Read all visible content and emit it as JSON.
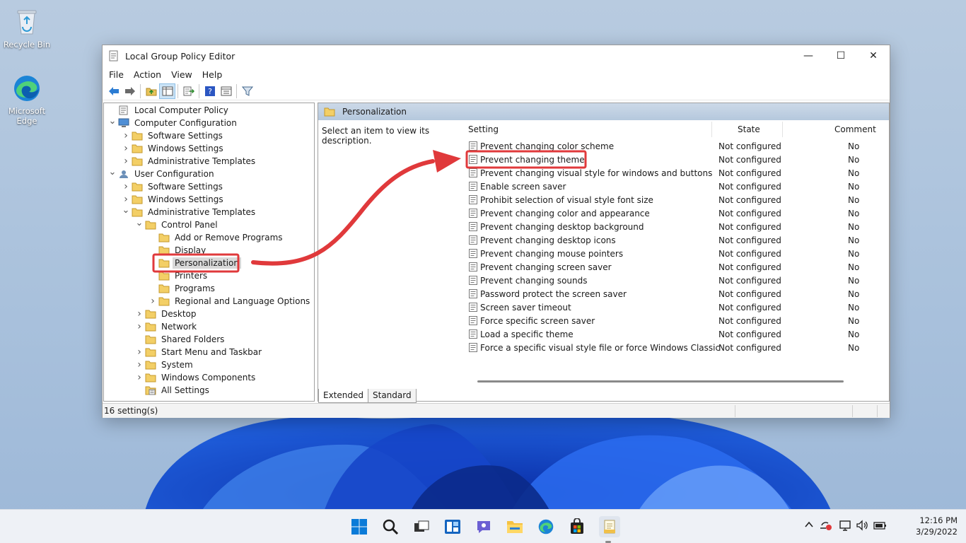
{
  "desktop": {
    "icons": [
      {
        "label": "Recycle Bin",
        "icon": "recycle-bin-icon"
      },
      {
        "label": "Microsoft Edge",
        "icon": "edge-icon"
      }
    ]
  },
  "window": {
    "title": "Local Group Policy Editor",
    "controls": {
      "minimize": "—",
      "maximize": "☐",
      "close": "✕"
    }
  },
  "menu": [
    "File",
    "Action",
    "View",
    "Help"
  ],
  "toolbar": [
    "back-icon",
    "forward-icon",
    "up-folder-icon",
    "show-hide-tree-icon",
    "export-list-icon",
    "help-icon",
    "properties-icon",
    "filter-icon"
  ],
  "tree": [
    {
      "label": "Local Computer Policy",
      "icon": "computer-policy-icon"
    },
    {
      "label": "Computer Configuration",
      "icon": "computer-icon"
    },
    {
      "label": "Software Settings",
      "icon": "folder-icon"
    },
    {
      "label": "Windows Settings",
      "icon": "folder-icon"
    },
    {
      "label": "Administrative Templates",
      "icon": "folder-icon"
    },
    {
      "label": "User Configuration",
      "icon": "user-icon"
    },
    {
      "label": "Software Settings",
      "icon": "folder-icon"
    },
    {
      "label": "Windows Settings",
      "icon": "folder-icon"
    },
    {
      "label": "Administrative Templates",
      "icon": "folder-icon"
    },
    {
      "label": "Control Panel",
      "icon": "folder-icon"
    },
    {
      "label": "Add or Remove Programs",
      "icon": "folder-icon"
    },
    {
      "label": "Display",
      "icon": "folder-icon"
    },
    {
      "label": "Personalization",
      "icon": "folder-icon",
      "selected": true
    },
    {
      "label": "Printers",
      "icon": "folder-icon"
    },
    {
      "label": "Programs",
      "icon": "folder-icon"
    },
    {
      "label": "Regional and Language Options",
      "icon": "folder-icon"
    },
    {
      "label": "Desktop",
      "icon": "folder-icon"
    },
    {
      "label": "Network",
      "icon": "folder-icon"
    },
    {
      "label": "Shared Folders",
      "icon": "folder-icon"
    },
    {
      "label": "Start Menu and Taskbar",
      "icon": "folder-icon"
    },
    {
      "label": "System",
      "icon": "folder-icon"
    },
    {
      "label": "Windows Components",
      "icon": "folder-icon"
    },
    {
      "label": "All Settings",
      "icon": "all-settings-icon"
    }
  ],
  "section": {
    "title": "Personalization",
    "description": "Select an item to view its description."
  },
  "columns": {
    "setting": "Setting",
    "state": "State",
    "comment": "Comment"
  },
  "policies": [
    {
      "setting": "Prevent changing color scheme",
      "state": "Not configured",
      "comment": "No"
    },
    {
      "setting": "Prevent changing theme",
      "state": "Not configured",
      "comment": "No",
      "highlighted": true
    },
    {
      "setting": "Prevent changing visual style for windows and buttons",
      "state": "Not configured",
      "comment": "No"
    },
    {
      "setting": "Enable screen saver",
      "state": "Not configured",
      "comment": "No"
    },
    {
      "setting": "Prohibit selection of visual style font size",
      "state": "Not configured",
      "comment": "No"
    },
    {
      "setting": "Prevent changing color and appearance",
      "state": "Not configured",
      "comment": "No"
    },
    {
      "setting": "Prevent changing desktop background",
      "state": "Not configured",
      "comment": "No"
    },
    {
      "setting": "Prevent changing desktop icons",
      "state": "Not configured",
      "comment": "No"
    },
    {
      "setting": "Prevent changing mouse pointers",
      "state": "Not configured",
      "comment": "No"
    },
    {
      "setting": "Prevent changing screen saver",
      "state": "Not configured",
      "comment": "No"
    },
    {
      "setting": "Prevent changing sounds",
      "state": "Not configured",
      "comment": "No"
    },
    {
      "setting": "Password protect the screen saver",
      "state": "Not configured",
      "comment": "No"
    },
    {
      "setting": "Screen saver timeout",
      "state": "Not configured",
      "comment": "No"
    },
    {
      "setting": "Force specific screen saver",
      "state": "Not configured",
      "comment": "No"
    },
    {
      "setting": "Load a specific theme",
      "state": "Not configured",
      "comment": "No"
    },
    {
      "setting": "Force a specific visual style file or force Windows Classic",
      "state": "Not configured",
      "comment": "No"
    }
  ],
  "tabs": [
    "Extended",
    "Standard"
  ],
  "status": "16 setting(s)",
  "annotation_color": "#e0393b",
  "taskbar": {
    "apps": [
      "start-icon",
      "search-icon",
      "task-view-icon",
      "widgets-icon",
      "chat-icon",
      "file-explorer-icon",
      "edge-icon",
      "store-icon",
      "group-policy-icon"
    ],
    "tray": [
      "chevron-up-icon",
      "network-alert-icon",
      "display-icon",
      "volume-icon",
      "battery-icon"
    ],
    "time": "12:16 PM",
    "date": "3/29/2022"
  }
}
